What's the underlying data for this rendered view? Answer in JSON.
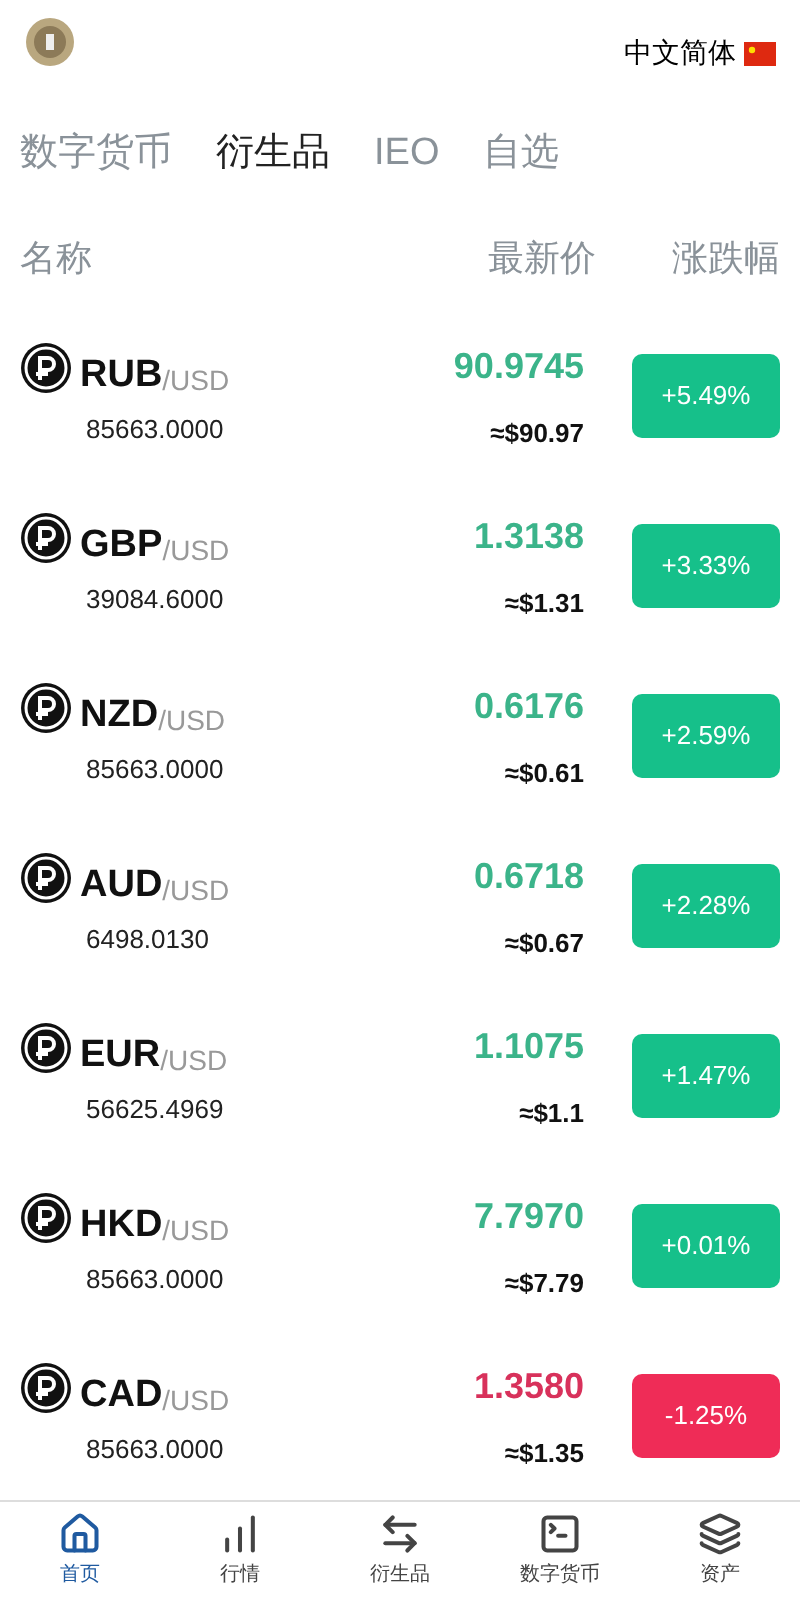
{
  "header": {
    "language": "中文简体"
  },
  "tabs": [
    {
      "label": "数字货币",
      "selected": false
    },
    {
      "label": "衍生品",
      "selected": true
    },
    {
      "label": "IEO",
      "selected": false
    },
    {
      "label": "自选",
      "selected": false
    }
  ],
  "columns": [
    "名称",
    "最新价",
    "涨跌幅"
  ],
  "rows": [
    {
      "symbol": "RUB",
      "quote": "/USD",
      "volume": "85663.0000",
      "price": "90.9745",
      "approx": "≈$90.97",
      "change": "+5.49%",
      "kind": "up"
    },
    {
      "symbol": "GBP",
      "quote": "/USD",
      "volume": "39084.6000",
      "price": "1.3138",
      "approx": "≈$1.31",
      "change": "+3.33%",
      "kind": "up"
    },
    {
      "symbol": "NZD",
      "quote": "/USD",
      "volume": "85663.0000",
      "price": "0.6176",
      "approx": "≈$0.61",
      "change": "+2.59%",
      "kind": "up"
    },
    {
      "symbol": "AUD",
      "quote": "/USD",
      "volume": "6498.0130",
      "price": "0.6718",
      "approx": "≈$0.67",
      "change": "+2.28%",
      "kind": "up"
    },
    {
      "symbol": "EUR",
      "quote": "/USD",
      "volume": "56625.4969",
      "price": "1.1075",
      "approx": "≈$1.1",
      "change": "+1.47%",
      "kind": "up"
    },
    {
      "symbol": "HKD",
      "quote": "/USD",
      "volume": "85663.0000",
      "price": "7.7970",
      "approx": "≈$7.79",
      "change": "+0.01%",
      "kind": "up"
    },
    {
      "symbol": "CAD",
      "quote": "/USD",
      "volume": "85663.0000",
      "price": "1.3580",
      "approx": "≈$1.35",
      "change": "-1.25%",
      "kind": "down"
    }
  ],
  "nav": [
    {
      "label": "首页",
      "selected": true
    },
    {
      "label": "行情",
      "selected": false
    },
    {
      "label": "衍生品",
      "selected": false
    },
    {
      "label": "数字货币",
      "selected": false
    },
    {
      "label": "资产",
      "selected": false
    }
  ]
}
